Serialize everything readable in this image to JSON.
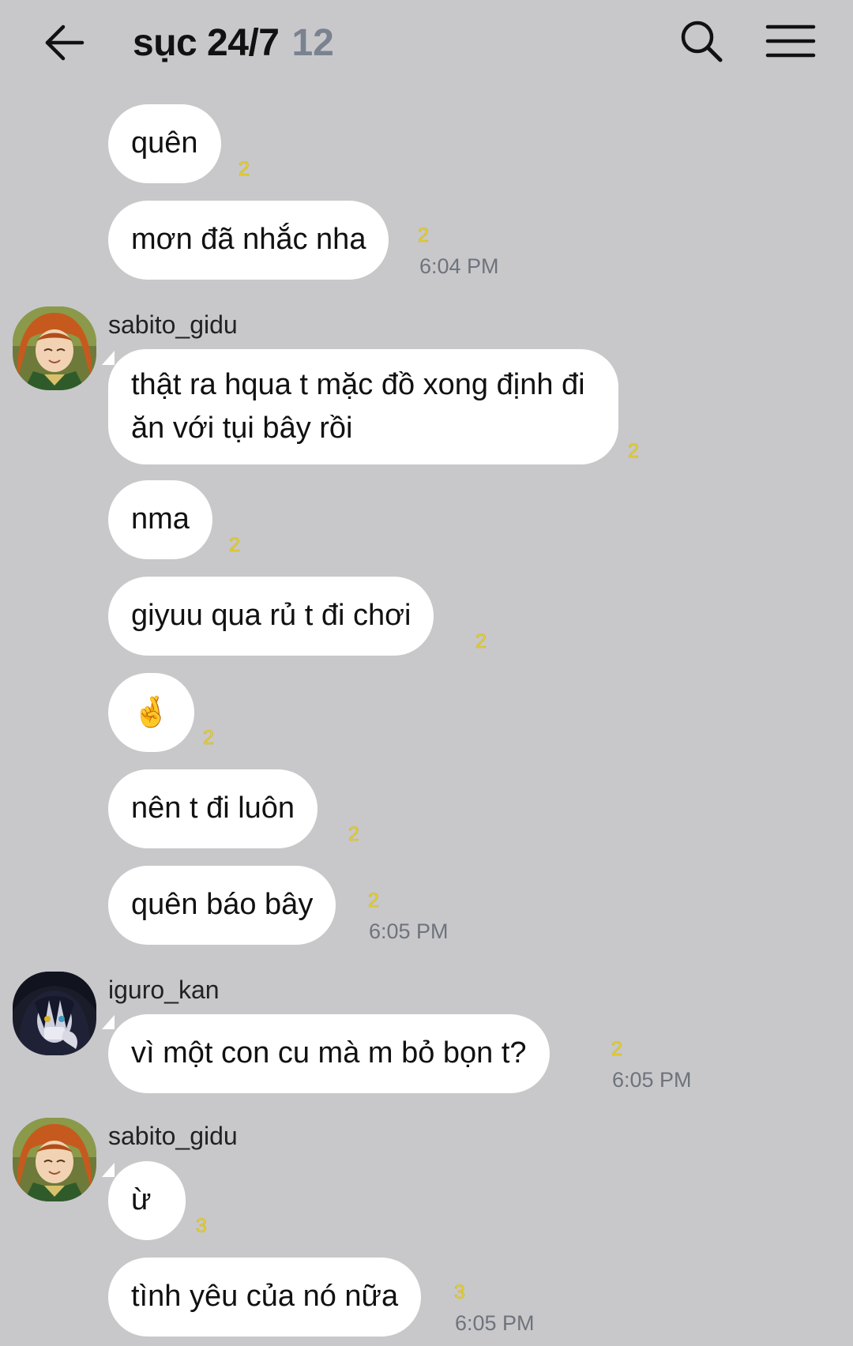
{
  "header": {
    "title": "sục 24/7",
    "member_count": "12"
  },
  "messages": [
    {
      "text": "quên",
      "unread": "2"
    },
    {
      "text": "mơn đã nhắc nha",
      "unread": "2",
      "time": "6:04 PM"
    },
    {
      "sender": "sabito_gidu"
    },
    {
      "text": "thật ra hqua t mặc đồ xong định đi ăn với tụi bây rồi",
      "unread": "2"
    },
    {
      "text": "nma",
      "unread": "2"
    },
    {
      "text": "giyuu qua rủ t đi chơi",
      "unread": "2"
    },
    {
      "text": "🤞",
      "unread": "2"
    },
    {
      "text": "nên t đi luôn",
      "unread": "2"
    },
    {
      "text": "quên báo bây",
      "unread": "2",
      "time": "6:05 PM"
    },
    {
      "sender": "iguro_kan"
    },
    {
      "text": "vì một con cu mà m bỏ bọn t?",
      "unread": "2",
      "time": "6:05 PM"
    },
    {
      "sender": "sabito_gidu"
    },
    {
      "text": "ừ",
      "unread": "3"
    },
    {
      "text": "tình yêu của nó nữa",
      "unread": "3",
      "time": "6:05 PM"
    }
  ],
  "icons": {
    "back": "arrow-left-icon",
    "search": "search-icon",
    "menu": "hamburger-menu-icon",
    "avatar_sabito": "avatar-orange-hair",
    "avatar_iguro": "avatar-dark-hair"
  },
  "colors": {
    "background": "#c8c8ca",
    "bubble": "#ffffff",
    "unread": "#e8d23a",
    "muted": "#7a8290"
  }
}
